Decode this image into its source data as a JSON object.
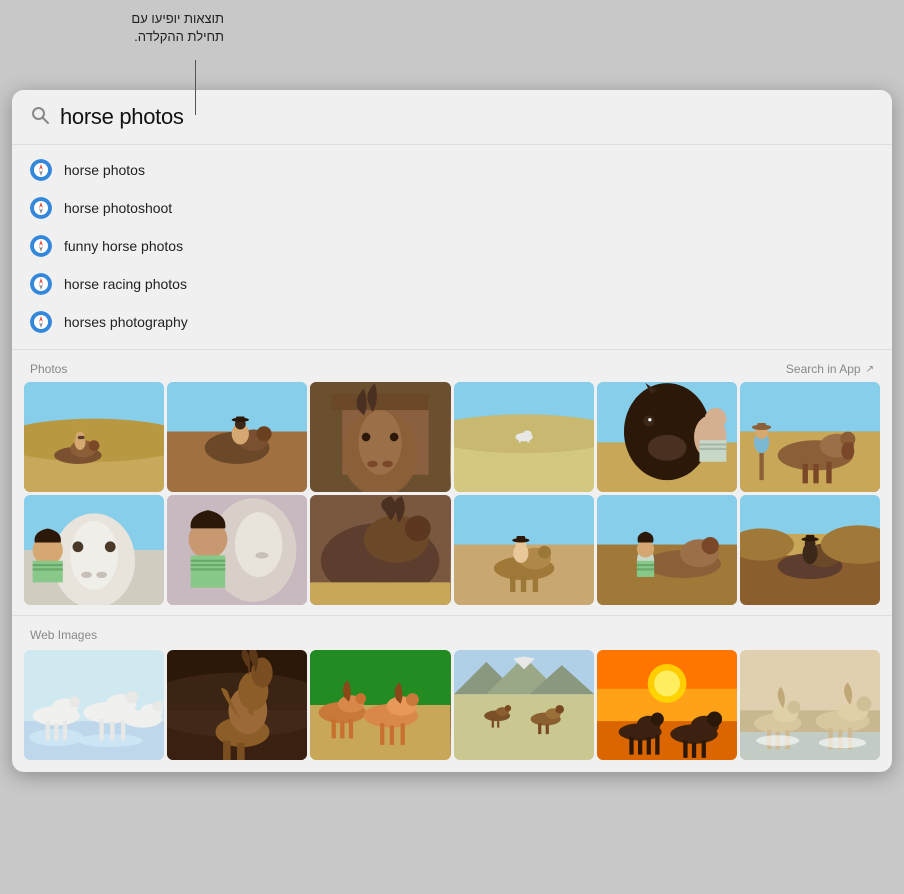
{
  "tooltip": {
    "line1": "תוצאות יופיעו עם",
    "line2": "תחילת ההקלדה."
  },
  "search": {
    "query": "horse photos",
    "placeholder": "horse photos"
  },
  "suggestions": [
    {
      "id": "s1",
      "text": "horse photos"
    },
    {
      "id": "s2",
      "text": "horse photoshoot"
    },
    {
      "id": "s3",
      "text": "funny horse photos"
    },
    {
      "id": "s4",
      "text": "horse racing photos"
    },
    {
      "id": "s5",
      "text": "horses photography"
    }
  ],
  "photos_section": {
    "title": "Photos",
    "search_in_app": "Search in App"
  },
  "web_images_section": {
    "title": "Web Images"
  },
  "icons": {
    "search": "🔍",
    "compass": "🧭",
    "arrow_right": "▶"
  }
}
